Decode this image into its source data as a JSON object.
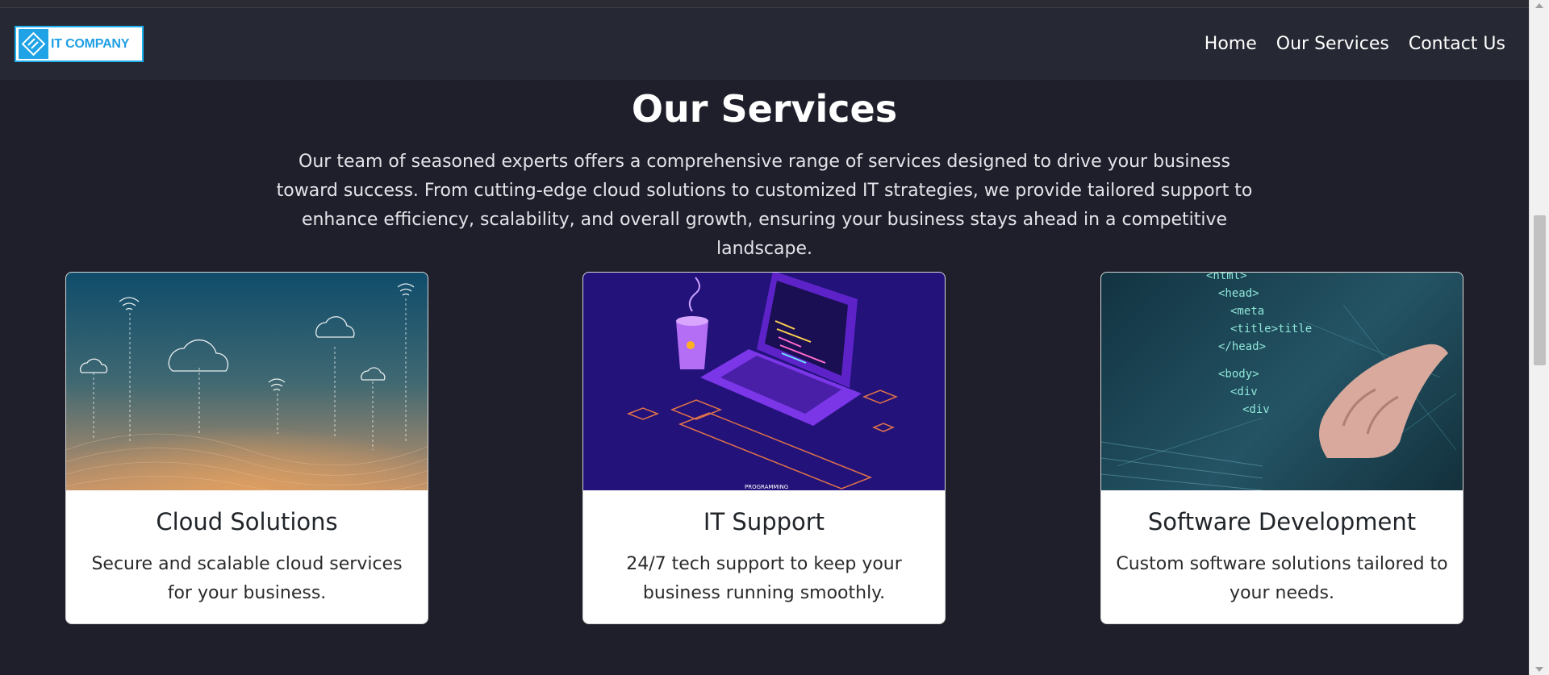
{
  "brand": {
    "logo_text": "IT COMPANY",
    "accent_color": "#1fb0f0"
  },
  "nav": {
    "links": [
      {
        "label": "Home"
      },
      {
        "label": "Our Services"
      },
      {
        "label": "Contact Us"
      }
    ]
  },
  "services": {
    "title": "Our Services",
    "description": "Our team of seasoned experts offers a comprehensive range of services designed to drive your business toward success. From cutting-edge cloud solutions to customized IT strategies, we provide tailored support to enhance efficiency, scalability, and overall growth, ensuring your business stays ahead in a competitive landscape.",
    "cards": [
      {
        "title": "Cloud Solutions",
        "text": "Secure and scalable cloud services for your business.",
        "image_icon": "cloud-network-illustration"
      },
      {
        "title": "IT Support",
        "text": "24/7 tech support to keep your business running smoothly.",
        "image_icon": "laptop-coffee-illustration"
      },
      {
        "title": "Software Development",
        "text": "Custom software solutions tailored to your needs.",
        "image_icon": "code-hand-illustration"
      }
    ]
  },
  "colors": {
    "page_background": "#1e1f2b",
    "navbar_background": "#262833",
    "card_background": "#ffffff"
  }
}
